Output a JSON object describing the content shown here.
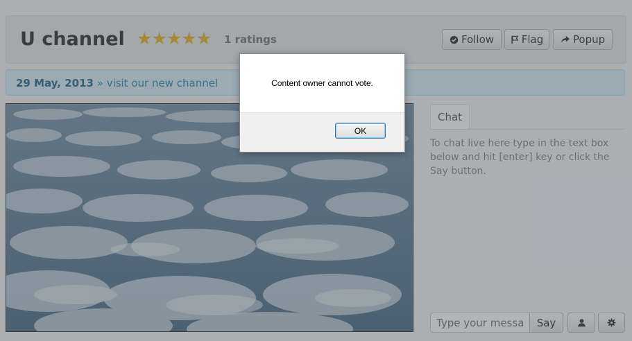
{
  "header": {
    "title": "U channel",
    "stars": "★★★★★",
    "ratings": "1 ratings",
    "follow_label": "Follow",
    "flag_label": "Flag",
    "popup_label": "Popup"
  },
  "announcement": {
    "date": "29 May, 2013",
    "separator": " » ",
    "link": "visit our new channel"
  },
  "chat": {
    "tab_label": "Chat",
    "help_text": "To chat live here type in the text box below and hit [enter] key or click the Say button.",
    "input_placeholder": "Type your message",
    "say_label": "Say",
    "user_icon": "user-icon",
    "settings_icon": "gear-icon"
  },
  "dialog": {
    "message": "Content owner cannot vote.",
    "ok_label": "OK"
  },
  "colors": {
    "star": "#e8b423",
    "alert_bg": "#d9edf7",
    "alert_text": "#3a87ad"
  }
}
